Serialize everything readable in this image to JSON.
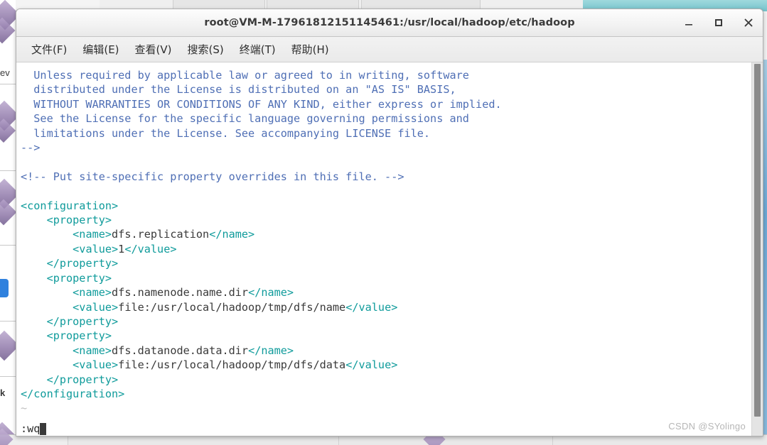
{
  "window": {
    "title": "root@VM-M-17961812151145461:/usr/local/hadoop/etc/hadoop",
    "controls": {
      "minimize_label": "_",
      "maximize_label": "□",
      "close_label": "×"
    }
  },
  "menubar": {
    "items": [
      {
        "label": "文件(F)",
        "name": "menu-file"
      },
      {
        "label": "编辑(E)",
        "name": "menu-edit"
      },
      {
        "label": "查看(V)",
        "name": "menu-view"
      },
      {
        "label": "搜索(S)",
        "name": "menu-search"
      },
      {
        "label": "终端(T)",
        "name": "menu-terminal"
      },
      {
        "label": "帮助(H)",
        "name": "menu-help"
      }
    ]
  },
  "editor": {
    "comment_block": [
      "  Unless required by applicable law or agreed to in writing, software",
      "  distributed under the License is distributed on an \"AS IS\" BASIS,",
      "  WITHOUT WARRANTIES OR CONDITIONS OF ANY KIND, either express or implied.",
      "  See the License for the specific language governing permissions and",
      "  limitations under the License. See accompanying LICENSE file."
    ],
    "comment_close": "-->",
    "blank_line": "",
    "site_comment": "<!-- Put site-specific property overrides in this file. -->",
    "config_open_tag": "<configuration>",
    "config_close_tag": "</configuration>",
    "properties": [
      {
        "open_tag": "<property>",
        "close_tag": "</property>",
        "name_open": "<name>",
        "name_value": "dfs.replication",
        "name_close": "</name>",
        "value_open": "<value>",
        "value_value": "1",
        "value_close": "</value>"
      },
      {
        "open_tag": "<property>",
        "close_tag": "</property>",
        "name_open": "<name>",
        "name_value": "dfs.namenode.name.dir",
        "name_close": "</name>",
        "value_open": "<value>",
        "value_value": "file:/usr/local/hadoop/tmp/dfs/name",
        "value_close": "</value>"
      },
      {
        "open_tag": "<property>",
        "close_tag": "</property>",
        "name_open": "<name>",
        "name_value": "dfs.datanode.data.dir",
        "name_close": "</name>",
        "value_open": "<value>",
        "value_value": "file:/usr/local/hadoop/tmp/dfs/data",
        "value_close": "</value>"
      }
    ],
    "empty_marker": "~",
    "command_line": ":wq",
    "colors": {
      "comment": "#4f6fb5",
      "tag": "#0f9b9b",
      "content": "#3a3a3a",
      "empty_marker": "#bfbfbf",
      "background": "#ffffff"
    }
  },
  "watermark": {
    "text": "CSDN @SYolingo"
  },
  "background": {
    "left_label_partial": "ev",
    "left_label_partial2": "k"
  }
}
